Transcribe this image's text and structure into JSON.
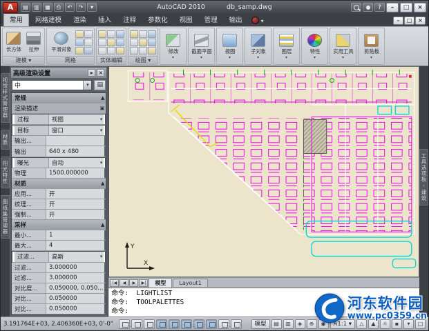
{
  "colors": {
    "accent_blue": "#1060c0",
    "canvas_bg": "#ede4cc",
    "magenta": "#e800e8",
    "cyan": "#00d8d8",
    "green": "#00a800",
    "yellow": "#e8d800"
  },
  "glyphs": {
    "dropdown": "▾",
    "collapse": "▲",
    "minimize": "–",
    "maximize": "□",
    "close": "×",
    "picture": "▣",
    "autohide": "▸",
    "save": "▤"
  },
  "titlebar": {
    "app_title": "AutoCAD 2010",
    "doc_name": "db_samp.dwg",
    "qat": [
      {
        "name": "new-button",
        "glyph": "▤"
      },
      {
        "name": "open-button",
        "glyph": "▥"
      },
      {
        "name": "save-button",
        "glyph": "▦"
      },
      {
        "name": "plot-button",
        "glyph": "⎙"
      },
      {
        "name": "undo-button",
        "glyph": "↶"
      },
      {
        "name": "redo-button",
        "glyph": "↷"
      },
      {
        "name": "qat-more-button",
        "glyph": "▾"
      }
    ]
  },
  "ribbon": {
    "tabs": [
      {
        "label": "常用",
        "state": "active"
      },
      {
        "label": "网格建模"
      },
      {
        "label": "渲染"
      },
      {
        "label": "插入"
      },
      {
        "label": "注释"
      },
      {
        "label": "参数化"
      },
      {
        "label": "视图"
      },
      {
        "label": "管理"
      },
      {
        "label": "输出"
      }
    ],
    "modeling_label": "建模 ▾",
    "modeling_buttons": [
      {
        "label": "长方体",
        "icon": "box"
      },
      {
        "label": "拉伸",
        "icon": "extrude"
      }
    ],
    "mesh_label": "网格",
    "mesh_button": {
      "label": "平滑对象",
      "icon": "smooth"
    },
    "solid_label": "实体编辑",
    "draw_label": "绘图 ▾",
    "collapsed_panels": [
      {
        "label": "修改",
        "icon": "modify",
        "arrow": "▾"
      },
      {
        "label": "截面平面",
        "icon": "section",
        "arrow": "▾"
      },
      {
        "label": "视图",
        "icon": "view",
        "arrow": "▾"
      },
      {
        "label": "子对象",
        "icon": "subobject",
        "arrow": "▾"
      },
      {
        "label": "图层",
        "icon": "layer",
        "arrow": "▾"
      },
      {
        "label": "特性",
        "icon": "properties",
        "arrow": "▾"
      },
      {
        "label": "实用工具",
        "icon": "utilities",
        "arrow": "▾"
      },
      {
        "label": "剪贴板",
        "icon": "clipboard",
        "arrow": "▾"
      }
    ]
  },
  "left_palette_tabs": [
    "视觉样式管理器",
    "材质",
    "阳光特性",
    "图纸集管理器"
  ],
  "right_palette_tab": "工具选项板 - 建筑",
  "palette": {
    "title": "高级渲染设置",
    "preset_value": "中",
    "rows": [
      {
        "kind": "header",
        "label": "常规",
        "label2": "▲"
      },
      {
        "kind": "subheader",
        "label": "渲染描述",
        "label2": "▣"
      },
      {
        "kind": "prop combo",
        "label": "过程",
        "value": "视图"
      },
      {
        "kind": "prop combo",
        "label": "目标",
        "value": "窗口"
      },
      {
        "kind": "prop",
        "label": "输出...",
        "value": ""
      },
      {
        "kind": "prop",
        "label": "输出",
        "value": "640 x 480"
      },
      {
        "kind": "prop combo",
        "label": "曝光",
        "value": "自动"
      },
      {
        "kind": "prop",
        "label": "物理",
        "value": "1500.000000"
      },
      {
        "kind": "header",
        "label": "材质",
        "label2": "▲"
      },
      {
        "kind": "prop",
        "label": "应用...",
        "value": "开"
      },
      {
        "kind": "prop",
        "label": "纹理...",
        "value": "开"
      },
      {
        "kind": "prop",
        "label": "强制...",
        "value": "开"
      },
      {
        "kind": "header",
        "label": "采样",
        "label2": "▲"
      },
      {
        "kind": "prop",
        "label": "最小...",
        "value": "1"
      },
      {
        "kind": "prop",
        "label": "最大...",
        "value": "4"
      },
      {
        "kind": "prop combo",
        "label": "过滤...",
        "value": "高斯"
      },
      {
        "kind": "prop",
        "label": "过滤...",
        "value": "3.000000"
      },
      {
        "kind": "prop",
        "label": "过滤...",
        "value": "3.000000"
      },
      {
        "kind": "prop",
        "label": "对比度...",
        "value": "0.050000, 0.050..."
      },
      {
        "kind": "prop",
        "label": "对比...",
        "value": "0.050000"
      },
      {
        "kind": "prop",
        "label": "对比...",
        "value": "0.050000"
      }
    ]
  },
  "canvas": {
    "ucs": {
      "x": "X",
      "y": "Y"
    }
  },
  "doc_tabs": {
    "nav": [
      "|◀",
      "◀",
      "▶",
      "▶|"
    ],
    "model": "模型",
    "layout1": "Layout1"
  },
  "command": {
    "history": [
      "命令:  LIGHTLIST",
      "命令:  TOOLPALETTES"
    ],
    "prompt": "命令:"
  },
  "statusbar": {
    "coords": "3.191764E+03, 2.406360E+03, 0'-0\"",
    "toggles": [
      {
        "name": "snap-toggle",
        "state": "off"
      },
      {
        "name": "grid-toggle",
        "state": "off"
      },
      {
        "name": "ortho-toggle",
        "state": "off"
      },
      {
        "name": "polar-toggle",
        "state": "on"
      },
      {
        "name": "osnap-toggle",
        "state": "on"
      },
      {
        "name": "otrack-toggle",
        "state": "on"
      },
      {
        "name": "ducs-toggle",
        "state": "on"
      },
      {
        "name": "dyn-toggle",
        "state": "on"
      },
      {
        "name": "lwt-toggle",
        "state": "off"
      },
      {
        "name": "qp-toggle",
        "state": "off"
      }
    ],
    "model_button": "模型",
    "right_icons": [
      {
        "name": "quick-view-drawings-button",
        "glyph": "▤"
      },
      {
        "name": "quick-view-layouts-button",
        "glyph": "▥"
      },
      {
        "name": "pan-button",
        "glyph": "◈"
      },
      {
        "name": "zoom-button",
        "glyph": "⊕"
      },
      {
        "name": "steering-wheel-button",
        "glyph": "◉"
      }
    ],
    "scale": "A1:1",
    "right_icons2": [
      {
        "name": "annotation-visibility-button",
        "glyph": "△"
      },
      {
        "name": "annotation-autoscale-button",
        "glyph": "▲"
      },
      {
        "name": "workspace-switch-button",
        "glyph": "☼"
      },
      {
        "name": "lock-ui-button",
        "glyph": "▪"
      },
      {
        "name": "status-menu-button",
        "glyph": "▾"
      },
      {
        "name": "clean-screen-button",
        "glyph": "□"
      }
    ]
  },
  "watermark": {
    "site_name": "河东软件园",
    "site_url": "www.pc0359.cn"
  }
}
